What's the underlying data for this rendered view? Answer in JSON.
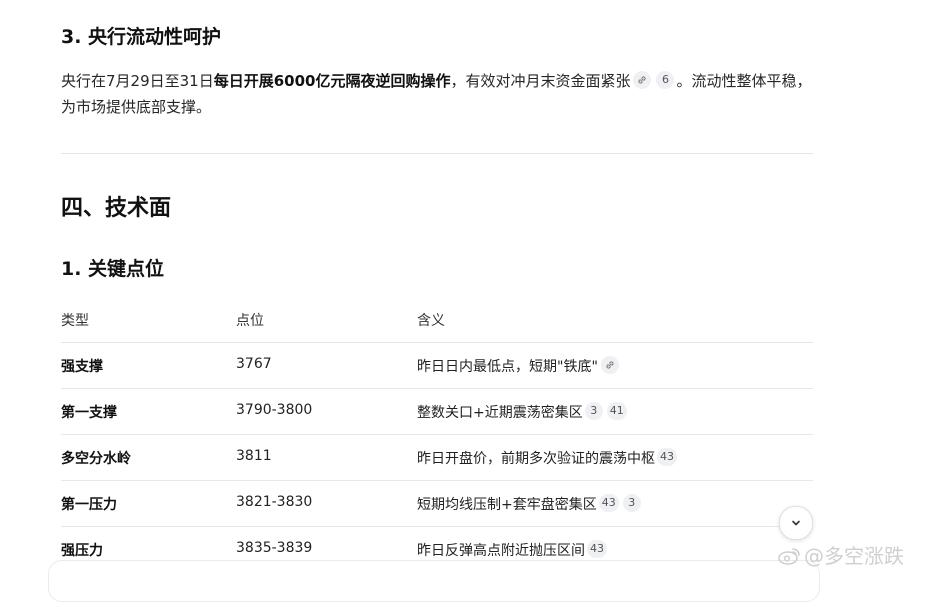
{
  "section3": {
    "heading": "3. 央行流动性呵护",
    "para_pre": "央行在7月29日至31日",
    "para_bold": "每日开展6000亿元隔夜逆回购操作",
    "para_mid": "，有效对冲月末资金面紧张",
    "citation": "6",
    "para_post": "。流动性整体平稳，为市场提供底部支撑。"
  },
  "section4": {
    "heading": "四、技术面",
    "subheading": "1. 关键点位"
  },
  "table": {
    "headers": [
      "类型",
      "点位",
      "含义"
    ],
    "rows": [
      {
        "type": "强支撑",
        "level": "3767",
        "meaning": "昨日日内最低点，短期\"铁底\"",
        "cites": []
      },
      {
        "type": "第一支撑",
        "level": "3790-3800",
        "meaning": "整数关口+近期震荡密集区",
        "cites": [
          "3",
          "41"
        ]
      },
      {
        "type": "多空分水岭",
        "level": "3811",
        "meaning": "昨日开盘价，前期多次验证的震荡中枢",
        "cites": [
          "43"
        ]
      },
      {
        "type": "第一压力",
        "level": "3821-3830",
        "meaning": "短期均线压制+套牢盘密集区",
        "cites": [
          "43",
          "3"
        ]
      },
      {
        "type": "强压力",
        "level": "3835-3839",
        "meaning": "昨日反弹高点附近抛压区间",
        "cites": [
          "43"
        ]
      }
    ]
  },
  "watermark": "@多空涨跌",
  "icons": {
    "link": "link-icon",
    "scroll_down": "chevron-down-icon",
    "weibo": "weibo-logo-icon"
  }
}
